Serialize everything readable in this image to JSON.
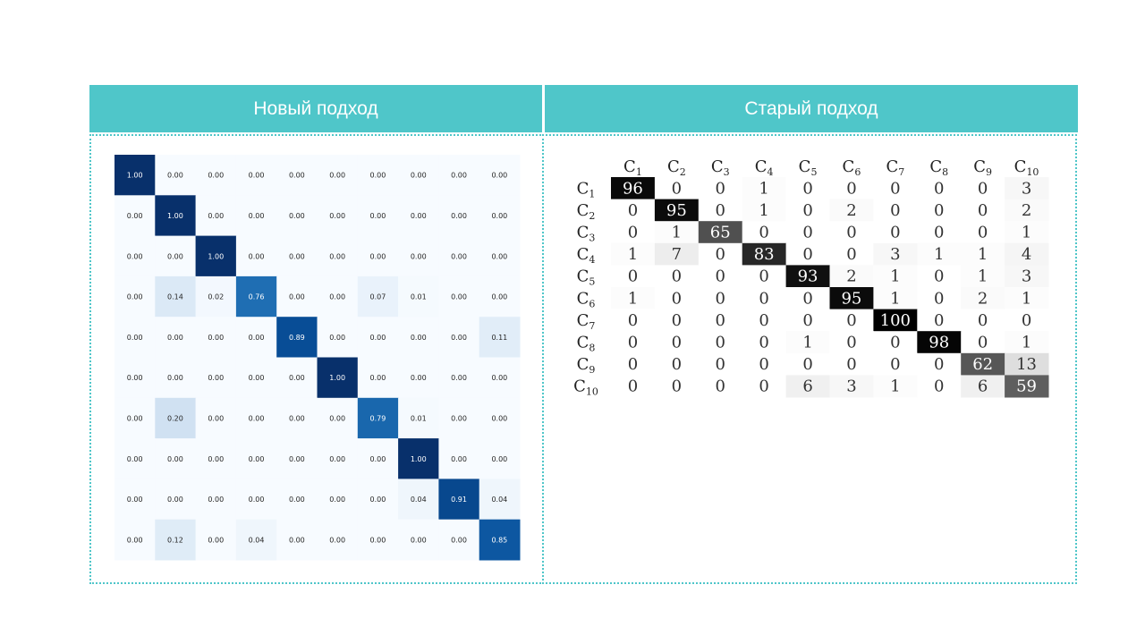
{
  "panels": {
    "left_title": "Новый подход",
    "right_title": "Старый подход"
  },
  "chart_data": [
    {
      "type": "heatmap",
      "colormap": "Blues",
      "values": [
        [
          1.0,
          0.0,
          0.0,
          0.0,
          0.0,
          0.0,
          0.0,
          0.0,
          0.0,
          0.0
        ],
        [
          0.0,
          1.0,
          0.0,
          0.0,
          0.0,
          0.0,
          0.0,
          0.0,
          0.0,
          0.0
        ],
        [
          0.0,
          0.0,
          1.0,
          0.0,
          0.0,
          0.0,
          0.0,
          0.0,
          0.0,
          0.0
        ],
        [
          0.0,
          0.14,
          0.02,
          0.76,
          0.0,
          0.0,
          0.07,
          0.01,
          0.0,
          0.0
        ],
        [
          0.0,
          0.0,
          0.0,
          0.0,
          0.89,
          0.0,
          0.0,
          0.0,
          0.0,
          0.11
        ],
        [
          0.0,
          0.0,
          0.0,
          0.0,
          0.0,
          1.0,
          0.0,
          0.0,
          0.0,
          0.0
        ],
        [
          0.0,
          0.2,
          0.0,
          0.0,
          0.0,
          0.0,
          0.79,
          0.01,
          0.0,
          0.0
        ],
        [
          0.0,
          0.0,
          0.0,
          0.0,
          0.0,
          0.0,
          0.0,
          1.0,
          0.0,
          0.0
        ],
        [
          0.0,
          0.0,
          0.0,
          0.0,
          0.0,
          0.0,
          0.0,
          0.04,
          0.91,
          0.04
        ],
        [
          0.0,
          0.12,
          0.0,
          0.04,
          0.0,
          0.0,
          0.0,
          0.0,
          0.0,
          0.85
        ]
      ]
    },
    {
      "type": "heatmap",
      "colormap": "Greys",
      "labels": [
        "C1",
        "C2",
        "C3",
        "C4",
        "C5",
        "C6",
        "C7",
        "C8",
        "C9",
        "C10"
      ],
      "values": [
        [
          96,
          0,
          0,
          1,
          0,
          0,
          0,
          0,
          0,
          3
        ],
        [
          0,
          95,
          0,
          1,
          0,
          2,
          0,
          0,
          0,
          2
        ],
        [
          0,
          1,
          65,
          0,
          0,
          0,
          0,
          0,
          0,
          1
        ],
        [
          1,
          7,
          0,
          83,
          0,
          0,
          3,
          1,
          1,
          4
        ],
        [
          0,
          0,
          0,
          0,
          93,
          2,
          1,
          0,
          1,
          3
        ],
        [
          1,
          0,
          0,
          0,
          0,
          95,
          1,
          0,
          2,
          1
        ],
        [
          0,
          0,
          0,
          0,
          0,
          0,
          100,
          0,
          0,
          0
        ],
        [
          0,
          0,
          0,
          0,
          1,
          0,
          0,
          98,
          0,
          1
        ],
        [
          0,
          0,
          0,
          0,
          0,
          0,
          0,
          0,
          62,
          13
        ],
        [
          0,
          0,
          0,
          0,
          6,
          3,
          1,
          0,
          6,
          59
        ]
      ]
    }
  ],
  "colors": {
    "header": "#4fc6c9"
  }
}
